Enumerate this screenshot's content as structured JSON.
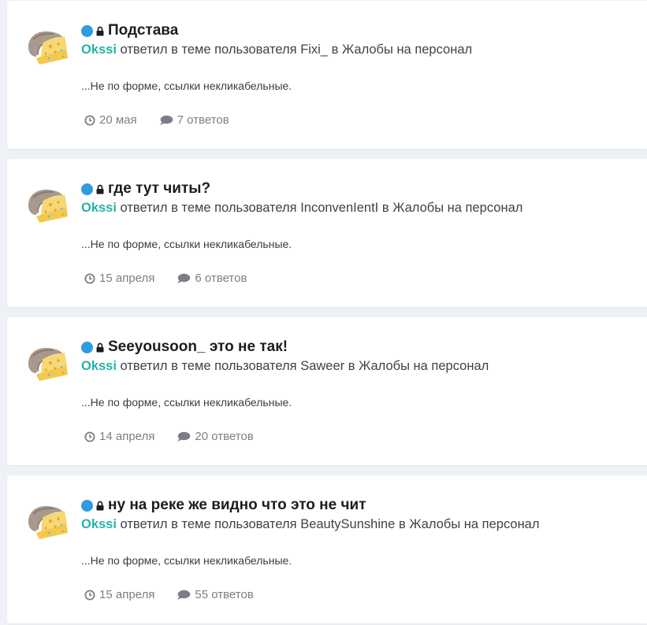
{
  "posts": [
    {
      "title": "Подстава",
      "author": "Okssi",
      "action_pre": " ответил в теме пользователя ",
      "topic_author": "Fixi_",
      "action_mid": " в ",
      "forum": "Жалобы на персонал",
      "snippet": "...Не по форме, ссылки некликабельные.",
      "date": "20 мая",
      "replies": "7 ответов"
    },
    {
      "title": "где тут читы?",
      "author": "Okssi",
      "action_pre": " ответил в теме пользователя ",
      "topic_author": "InconvenIentI",
      "action_mid": " в ",
      "forum": "Жалобы на персонал",
      "snippet": "...Не по форме, ссылки некликабельные.",
      "date": "15 апреля",
      "replies": "6 ответов"
    },
    {
      "title": "Seeyousoon_ это не так!",
      "author": "Okssi",
      "action_pre": " ответил в теме пользователя ",
      "topic_author": "Saweer",
      "action_mid": " в ",
      "forum": "Жалобы на персонал",
      "snippet": "...Не по форме, ссылки некликабельные.",
      "date": "14 апреля",
      "replies": "20 ответов"
    },
    {
      "title": "ну на реке же видно что это не чит",
      "author": "Okssi",
      "action_pre": " ответил в теме пользователя ",
      "topic_author": "BeautySunshine",
      "action_mid": " в ",
      "forum": "Жалобы на персонал",
      "snippet": "...Не по форме, ссылки некликабельные.",
      "date": "15 апреля",
      "replies": "55 ответов"
    }
  ],
  "icons": {
    "status": "unread-dot-icon",
    "locked": "lock-icon",
    "date": "clock-icon",
    "replies": "comment-icon"
  },
  "colors": {
    "accent": "#27b2a8",
    "status_dot": "#2f9be0",
    "background": "#eef1f5",
    "card": "#ffffff",
    "muted": "#7a7f87"
  }
}
